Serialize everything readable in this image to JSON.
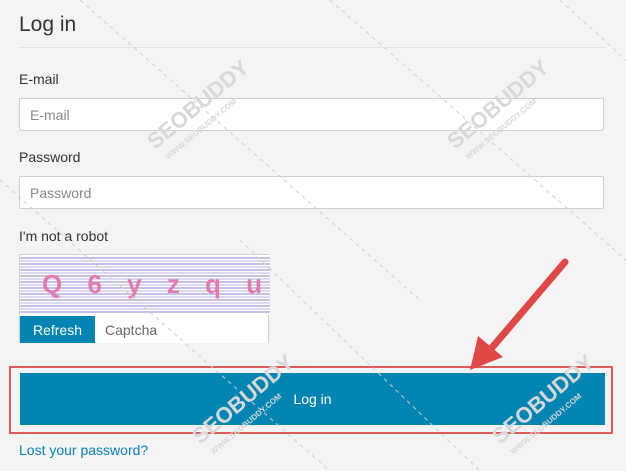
{
  "page": {
    "title": "Log in"
  },
  "form": {
    "email_label": "E-mail",
    "email_placeholder": "E-mail",
    "password_label": "Password",
    "password_placeholder": "Password",
    "robot_label": "I'm not a robot",
    "captcha_text": "Q 6 y z q u",
    "refresh_label": "Refresh",
    "captcha_placeholder": "Captcha",
    "login_label": "Log in",
    "lost_password_label": "Lost your password?"
  },
  "watermark": {
    "text": "SEOBUDDY",
    "sub": "WWW.SEOBUDDY.COM"
  },
  "colors": {
    "primary": "#0085b2",
    "highlight": "#e05a5a",
    "link": "#0a7fb8"
  }
}
